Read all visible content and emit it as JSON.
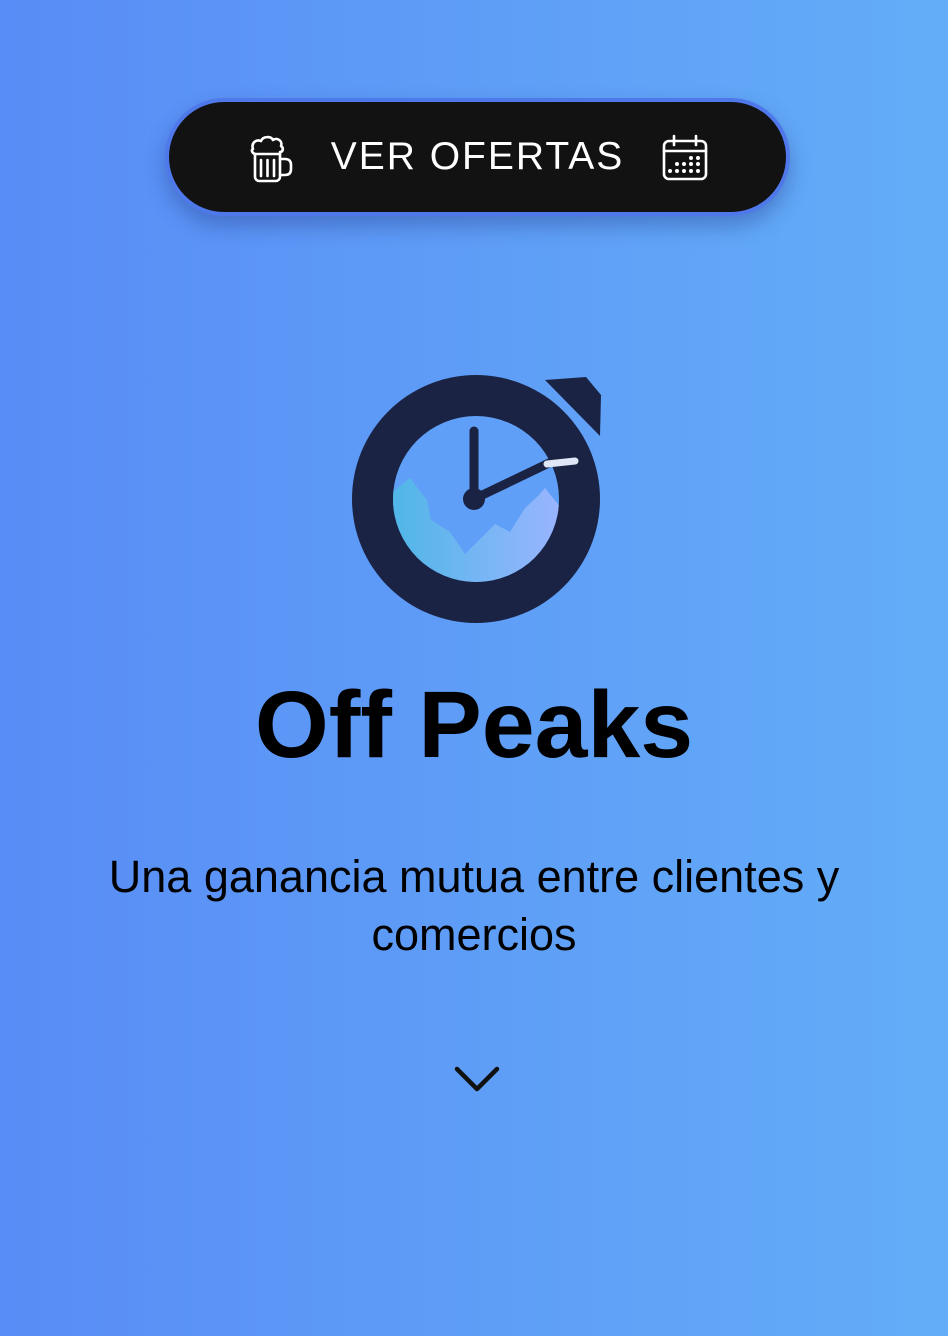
{
  "cta": {
    "label": "VER OFERTAS",
    "left_icon": "beer-mug-icon",
    "right_icon": "calendar-icon"
  },
  "hero": {
    "logo": "stopwatch-logo",
    "title": "Off Peaks",
    "subtitle": "Una ganancia mutua entre clientes y comercios"
  },
  "scroll": {
    "icon": "chevron-down-icon"
  },
  "colors": {
    "background_start": "#588cf6",
    "background_end": "#63adf8",
    "button_bg": "#121212",
    "button_border": "#4f78ea",
    "logo_ring": "#1a2344"
  }
}
